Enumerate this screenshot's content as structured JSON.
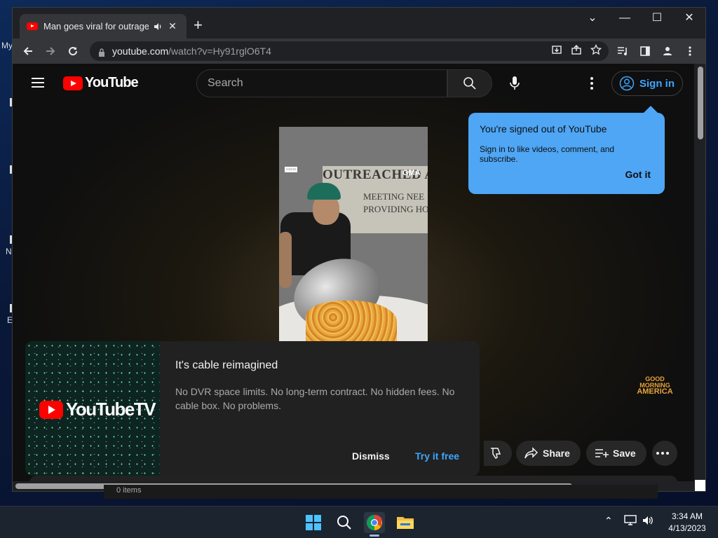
{
  "desktop": {
    "fragments": [
      "My",
      "N",
      "E"
    ]
  },
  "browser": {
    "tab_title": "Man goes viral for outrageous",
    "url_host": "youtube.com",
    "url_path": "/watch?v=Hy91rglO6T4",
    "icons": {
      "tab_favicon": "youtube-favicon",
      "tab_audio": "speaker-icon",
      "tab_close": "close-icon",
      "new_tab": "plus-icon",
      "back": "arrow-left-icon",
      "forward": "arrow-right-icon",
      "reload": "reload-icon",
      "lock": "lock-icon",
      "install": "install-icon",
      "share": "share-icon",
      "bookmark": "star-icon",
      "reading_list": "reading-list-icon",
      "side_panel": "side-panel-icon",
      "profile": "profile-icon",
      "menu": "kebab-icon"
    }
  },
  "youtube": {
    "logo_text": "YouTube",
    "search_placeholder": "Search",
    "signin_label": "Sign in",
    "tooltip": {
      "title": "You're signed out of YouTube",
      "body": "Sign in to like videos, comment, and subscribe.",
      "button": "Got it"
    },
    "video": {
      "banner_line1": "OUTREACHED AM",
      "banner_line2": "MEETING NEE",
      "banner_line3": "PROVIDING HO",
      "gma_tag": "GMA",
      "corner_logo": [
        "GOOD",
        "MORNING",
        "AMERICA"
      ]
    },
    "promo": {
      "logo_text": "YouTubeTV",
      "title": "It's cable reimagined",
      "description": "No DVR space limits. No long-term contract. No hidden fees. No cable box. No problems.",
      "dismiss": "Dismiss",
      "try": "Try it free"
    },
    "actions": {
      "share": "Share",
      "save": "Save"
    },
    "under_strip": "0 items"
  },
  "taskbar": {
    "time": "3:34 AM",
    "date": "4/13/2023"
  }
}
